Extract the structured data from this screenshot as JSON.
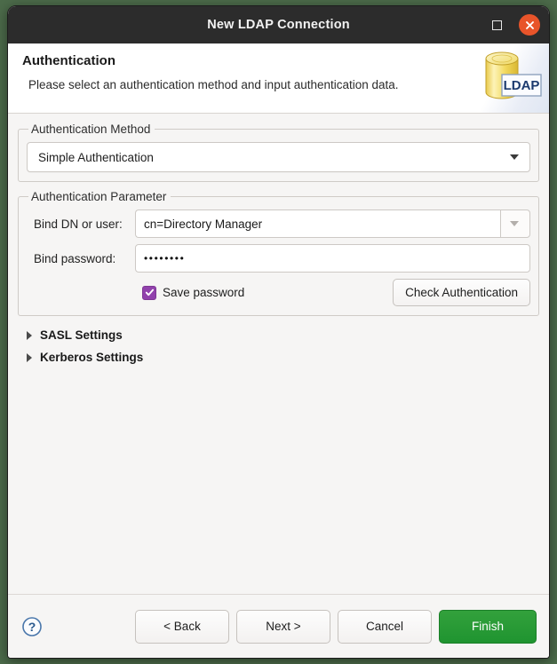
{
  "window": {
    "title": "New LDAP Connection",
    "maximize_icon": "maximize-icon",
    "close_icon": "close-icon"
  },
  "header": {
    "title": "Authentication",
    "description": "Please select an authentication method and input authentication data.",
    "image_label": "LDAP",
    "image_icon": "ldap-database-icon"
  },
  "auth_method": {
    "group_label": "Authentication Method",
    "selected": "Simple Authentication",
    "options": [
      "Simple Authentication"
    ],
    "caret_icon": "chevron-down-icon"
  },
  "auth_parameter": {
    "group_label": "Authentication Parameter",
    "bind_dn_label": "Bind DN or user:",
    "bind_dn_value": "cn=Directory Manager",
    "bind_dn_caret_icon": "chevron-down-icon",
    "bind_password_label": "Bind password:",
    "bind_password_value": "••••••••",
    "save_password_label": "Save password",
    "save_password_checked": true,
    "check_icon": "checkmark-icon",
    "check_auth_label": "Check Authentication"
  },
  "expanders": [
    {
      "label": "SASL Settings",
      "arrow_icon": "triangle-right-icon",
      "expanded": false
    },
    {
      "label": "Kerberos Settings",
      "arrow_icon": "triangle-right-icon",
      "expanded": false
    }
  ],
  "footer": {
    "help_icon": "help-circle-icon",
    "back_label": "< Back",
    "next_label": "Next >",
    "cancel_label": "Cancel",
    "finish_label": "Finish"
  },
  "colors": {
    "titlebar": "#2c2c2c",
    "close_button": "#e8542a",
    "checkbox_accent": "#9141ac",
    "finish_button": "#1f9430",
    "desktop": "#4c6b4a",
    "body": "#f6f5f4"
  }
}
